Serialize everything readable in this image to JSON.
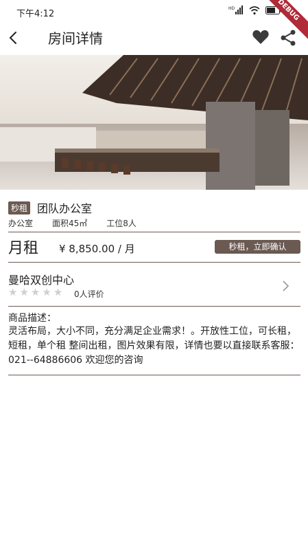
{
  "status_bar": {
    "time": "下午4:12",
    "hd_label": "HD"
  },
  "debug_banner": "DEBUG",
  "app_bar": {
    "title": "房间详情"
  },
  "room": {
    "tag": "秒租",
    "name": "团队办公室",
    "type": "办公室",
    "area": "面积45㎡",
    "seats": "工位8人",
    "rent_label": "月租",
    "price": "¥ 8,850.00 / 月",
    "confirm_button": "秒租，立即确认"
  },
  "center": {
    "name": "曼哈双创中心",
    "rating_stars": 0,
    "max_stars": 5,
    "reviews": "0人评价"
  },
  "description": {
    "title": "商品描述：",
    "text": "灵活布局，大小不同，充分满足企业需求！。开放性工位，可长租，短租，单个租 整间出租，图片效果有限，详情也要以直接联系客服：021--64886606 欢迎您的咨询"
  },
  "colors": {
    "accent": "#6b5a52",
    "divider": "#6b5a52",
    "debug": "#b02a37"
  }
}
